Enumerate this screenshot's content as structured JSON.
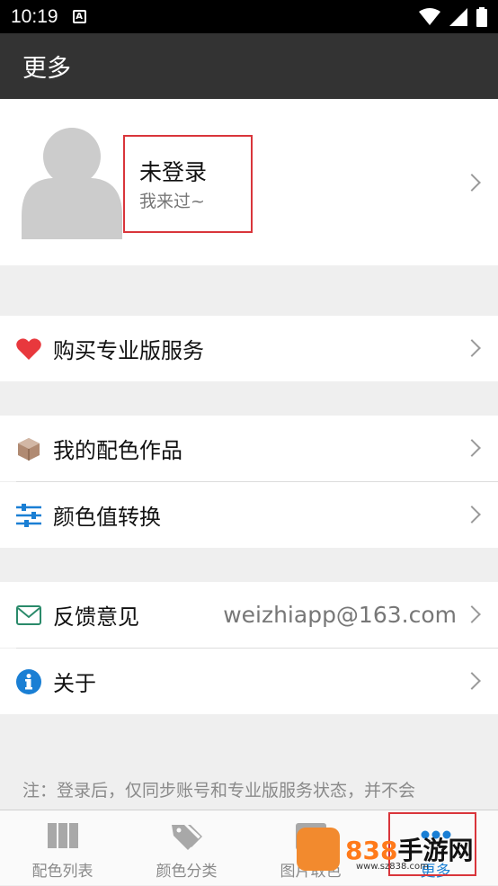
{
  "status_bar": {
    "time": "10:19",
    "notification_icon": "a-icon"
  },
  "app_bar": {
    "title": "更多"
  },
  "profile": {
    "title": "未登录",
    "subtitle": "我来过~"
  },
  "menu": {
    "pro": {
      "label": "购买专业版服务",
      "icon": "heart-icon",
      "color": "#e8383d"
    },
    "works": {
      "label": "我的配色作品",
      "icon": "box-icon"
    },
    "convert": {
      "label": "颜色值转换",
      "icon": "sliders-icon"
    },
    "feedback": {
      "label": "反馈意见",
      "value": "weizhiapp@163.com",
      "icon": "mail-icon"
    },
    "about": {
      "label": "关于",
      "icon": "info-icon"
    }
  },
  "note": "注：登录后，仅同步账号和专业版服务状态，并不会",
  "tabs": [
    {
      "label": "配色列表",
      "icon": "grid-icon"
    },
    {
      "label": "颜色分类",
      "icon": "tags-icon"
    },
    {
      "label": "图片取色",
      "icon": "image-icon"
    },
    {
      "label": "更多",
      "icon": "more-icon"
    }
  ],
  "watermark": {
    "number": "838",
    "name": "手游网",
    "url": "www.sz838.com"
  },
  "colors": {
    "accent": "#1a7fd4",
    "highlight": "#d9353b"
  }
}
